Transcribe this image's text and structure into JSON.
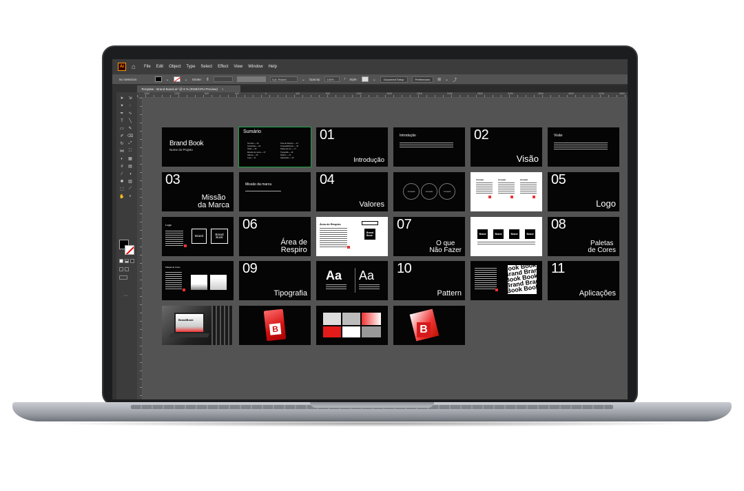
{
  "menu": {
    "app_badge": "Ai",
    "items": [
      "File",
      "Edit",
      "Object",
      "Type",
      "Select",
      "Effect",
      "View",
      "Window",
      "Help"
    ]
  },
  "control": {
    "selection": "No Selection",
    "stroke_label": "Stroke:",
    "brush": "3 pt. Round",
    "opacity_label": "Opacity:",
    "opacity_value": "100%",
    "style_label": "Style:",
    "document_setup": "Document Setup",
    "preferences": "Preferences"
  },
  "document": {
    "tab_title": "Template - Brand Board.ai* @ 9 % (RGB/CPU Preview)",
    "ruler_labels": [
      "1600",
      "1200",
      "800",
      "400",
      "0",
      "400",
      "800",
      "1200",
      "1600",
      "2000",
      "2400",
      "2800",
      "3200",
      "3600",
      "4000",
      "4400",
      "4800"
    ]
  },
  "slides": {
    "brand_book_title": "Brand Book",
    "brand_book_sub": "Nome do Projeto",
    "sumario_title": "Sumário",
    "sumario_left": [
      "Sumário — 02",
      "Introdução — 03",
      "Visão — 05",
      "Missão da marca — 07",
      "Valores — 09",
      "Logo — 11"
    ],
    "sumario_right": [
      "Área de Respiro — 13",
      "Ocupação/Fazer — 15",
      "Paleta de Cor — 17",
      "Tipografia — 19",
      "Pattern — 21",
      "Aplicações — 23"
    ],
    "n01": "01",
    "t01": "Introdução",
    "intro_title": "Introdução",
    "n02": "02",
    "t02": "Visão",
    "visao_title": "Visão",
    "n03": "03",
    "t03a": "Missão",
    "t03b": "da Marca",
    "missao_title": "Missão da marca",
    "n04": "04",
    "t04": "Valores",
    "circle_label": "Inovação",
    "n05": "05",
    "t05": "Logo",
    "logo_title": "Logo",
    "logo_box1": "Brand",
    "logo_box2a": "Brand",
    "logo_box2b": "Book",
    "n06": "06",
    "t06a": "Área de",
    "t06b": "Respiro",
    "respiro_title": "Área de Respiro",
    "n07": "07",
    "t07a": "O que",
    "t07b": "Não Fazer",
    "n08": "08",
    "t08a": "Paletas",
    "t08b": "de Cores",
    "cores_title": "Paletas de Cores",
    "n09": "09",
    "t09": "Tipografia",
    "aa": "Aa",
    "n10": "10",
    "t10": "Pattern",
    "n11": "11",
    "t11": "Aplicações",
    "mock_brandbook": "BrandBook",
    "letter_b": "B"
  }
}
